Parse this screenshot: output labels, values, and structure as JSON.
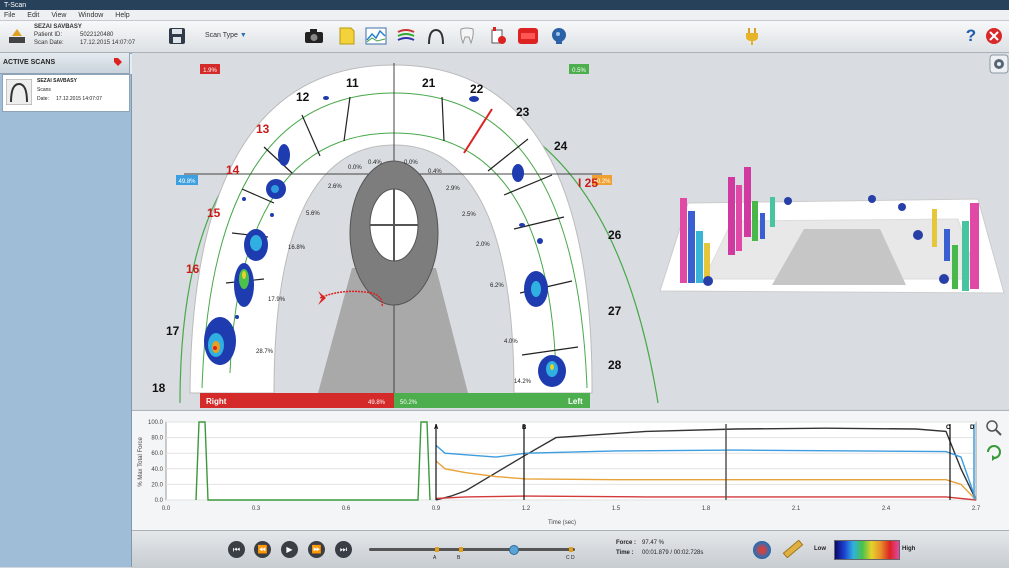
{
  "app": {
    "title": "T-Scan"
  },
  "menu": [
    "File",
    "Edit",
    "View",
    "Window",
    "Help"
  ],
  "patient": {
    "name": "SEZAI SAVBASY",
    "id_label": "Patient ID:",
    "id_value": "5022120480",
    "date_label": "Scan Date:",
    "date_value": "17.12.2015 14:07:07"
  },
  "toolbar": {
    "scan_type_label": "Scan Type"
  },
  "left_panel": {
    "header": "ACTIVE SCANS",
    "card": {
      "name": "SEZAI SAVBASY",
      "line2": "Scans",
      "date_label": "Date:",
      "date_value": "17.12.2015 14:07:07"
    }
  },
  "arch": {
    "right_badge": "1.9%",
    "left_badge": "0.5%",
    "right_side_badge": "49.8%",
    "left_side_badge": "50.2%",
    "teeth_black": [
      "11",
      "12",
      "17",
      "18",
      "21",
      "22",
      "23",
      "24",
      "26",
      "27",
      "28"
    ],
    "teeth_red": [
      "13",
      "14",
      "15",
      "16",
      "I 25"
    ],
    "percentages": [
      "0.0%",
      "0.4%",
      "0.0%",
      "0.4%",
      "2.6%",
      "2.9%",
      "5.6%",
      "2.5%",
      "16.8%",
      "2.0%",
      "17.9%",
      "6.2%",
      "28.7%",
      "4.0%",
      "14.2%"
    ],
    "right_bar": {
      "label": "Right",
      "value": "49.8%"
    },
    "left_bar": {
      "label": "Left",
      "value": "50.2%"
    },
    "colors": {
      "right": "#d42a2a",
      "left": "#4cae4c"
    }
  },
  "graph": {
    "ylabel": "% Max Total Force",
    "xlabel": "Time (sec)",
    "yticks": [
      "0.0",
      "20.0",
      "40.0",
      "60.0",
      "80.0",
      "100.0"
    ],
    "xticks": [
      "0.0",
      "0.3",
      "0.6",
      "0.9",
      "1.2",
      "1.5",
      "1.8",
      "2.1",
      "2.4",
      "2.7"
    ],
    "markers": [
      "A",
      "B",
      "C",
      "D"
    ]
  },
  "chart_data": {
    "type": "line",
    "xlabel": "Time (sec)",
    "ylabel": "% Max Total Force",
    "xlim": [
      0,
      2.7
    ],
    "ylim": [
      0,
      100
    ],
    "series": [
      {
        "color": "#333333",
        "x": [
          0.9,
          0.95,
          1.0,
          1.1,
          1.2,
          1.3,
          1.6,
          1.9,
          2.2,
          2.5,
          2.6,
          2.65,
          2.7
        ],
        "y": [
          0,
          5,
          12,
          35,
          58,
          80,
          88,
          91,
          92,
          91,
          88,
          40,
          0
        ]
      },
      {
        "color": "#3c9de0",
        "x": [
          0.9,
          0.93,
          1.0,
          1.1,
          1.2,
          1.5,
          1.9,
          2.3,
          2.6,
          2.65,
          2.7
        ],
        "y": [
          70,
          60,
          58,
          55,
          60,
          63,
          64,
          63,
          62,
          55,
          0
        ]
      },
      {
        "color": "#e8a23a",
        "x": [
          0.9,
          0.93,
          1.0,
          1.1,
          1.2,
          1.5,
          1.9,
          2.3,
          2.6,
          2.65,
          2.7
        ],
        "y": [
          50,
          40,
          35,
          30,
          27,
          26,
          26,
          26,
          26,
          20,
          0
        ]
      },
      {
        "color": "#d33a3a",
        "x": [
          0.9,
          1.0,
          1.2,
          1.6,
          2.0,
          2.4,
          2.6,
          2.7
        ],
        "y": [
          2,
          4,
          5,
          4,
          4,
          4,
          4,
          0
        ]
      },
      {
        "color": "#3a9a3a",
        "x": [
          0.1,
          0.11,
          0.13,
          0.14,
          0.84,
          0.85,
          0.87,
          0.88
        ],
        "y": [
          0,
          100,
          100,
          0,
          0,
          100,
          100,
          0
        ]
      }
    ]
  },
  "status": {
    "force_label": "Force :",
    "force_value": "97.47 %",
    "time_label": "Time :",
    "time_value": "00:01.879 / 00:02.728s",
    "low_label": "Low",
    "high_label": "High",
    "slider_markers": [
      "A",
      "B",
      "C",
      "D"
    ],
    "slider_position": 0.7
  }
}
